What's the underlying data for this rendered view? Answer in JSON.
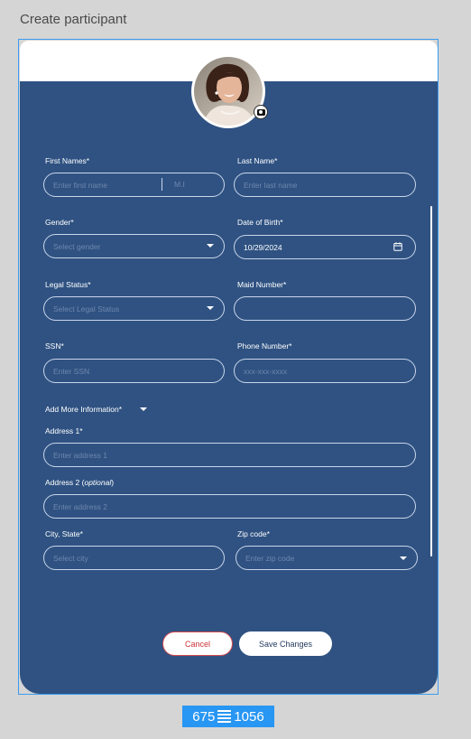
{
  "page": {
    "title": "Create participant"
  },
  "form": {
    "first_names": {
      "label": "First Names*",
      "placeholder": "Enter first name",
      "mi_placeholder": "M.I"
    },
    "last_name": {
      "label": "Last Name*",
      "placeholder": "Enter last name"
    },
    "gender": {
      "label": "Gender*",
      "placeholder": "Select gender"
    },
    "dob": {
      "label": "Date of Birth*",
      "value": "10/29/2024"
    },
    "legal_status": {
      "label": "Legal Status*",
      "placeholder": "Select Legal Status"
    },
    "maid_number": {
      "label": "Maid Number*",
      "value": ""
    },
    "ssn": {
      "label": "SSN*",
      "placeholder": "Enter SSN"
    },
    "phone": {
      "label": "Phone Number*",
      "placeholder": "xxx-xxx-xxxx"
    },
    "more_info": {
      "label": "Add More Information*"
    },
    "address1": {
      "label": "Address 1*",
      "placeholder": "Enter address 1"
    },
    "address2": {
      "label_main": "Address 2 (",
      "label_optional": "optional",
      "label_end": ")",
      "placeholder": "Enter address 2"
    },
    "city_state": {
      "label": "City, State*",
      "placeholder": "Select city"
    },
    "zip": {
      "label": "Zip code*",
      "placeholder": "Enter zip code"
    }
  },
  "actions": {
    "cancel": "Cancel",
    "save": "Save Changes"
  },
  "size_badge": {
    "width": "675",
    "height": "1056"
  },
  "colors": {
    "card_bg": "#2f5282",
    "field_border": "#c9d6ea",
    "placeholder": "#6f87ad",
    "cancel_text": "#c9333a",
    "selection_blue": "#2896f3"
  },
  "icons": [
    "camera-icon",
    "chevron-down-icon",
    "calendar-icon"
  ]
}
